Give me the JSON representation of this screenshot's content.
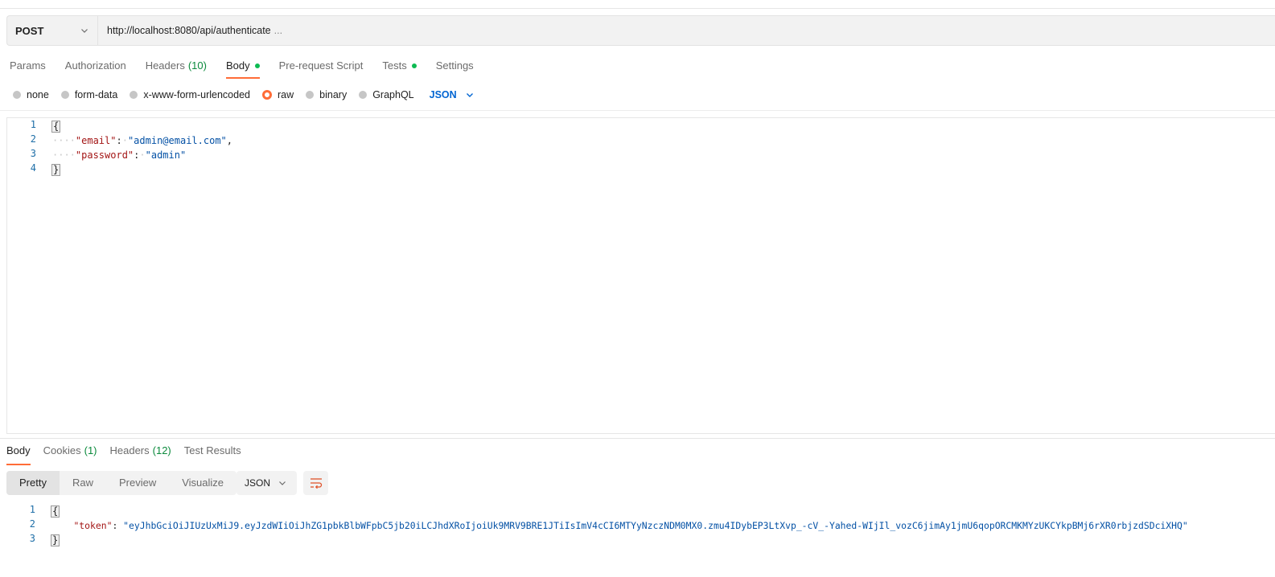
{
  "request": {
    "method": "POST",
    "url": "http://localhost:8080/api/authenticate",
    "url_overflow": "..."
  },
  "request_tabs": [
    {
      "label": "Params"
    },
    {
      "label": "Authorization"
    },
    {
      "label": "Headers",
      "count": "(10)"
    },
    {
      "label": "Body",
      "dot": true
    },
    {
      "label": "Pre-request Script"
    },
    {
      "label": "Tests",
      "dot": true
    },
    {
      "label": "Settings"
    }
  ],
  "body_types": [
    "none",
    "form-data",
    "x-www-form-urlencoded",
    "raw",
    "binary",
    "GraphQL"
  ],
  "body_type_selected": "raw",
  "body_language": "JSON",
  "request_body": {
    "line_numbers": [
      "1",
      "2",
      "3",
      "4"
    ],
    "open_brace": "{",
    "close_brace": "}",
    "email_key": "\"email\"",
    "email_value": "\"admin@email.com\"",
    "password_key": "\"password\"",
    "password_value": "\"admin\""
  },
  "response_tabs": [
    {
      "label": "Body"
    },
    {
      "label": "Cookies",
      "count": "(1)"
    },
    {
      "label": "Headers",
      "count": "(12)"
    },
    {
      "label": "Test Results"
    }
  ],
  "response_views": [
    "Pretty",
    "Raw",
    "Preview",
    "Visualize"
  ],
  "response_format": "JSON",
  "response_body": {
    "line_numbers": [
      "1",
      "2",
      "3"
    ],
    "open_brace": "{",
    "close_brace": "}",
    "token_key": "\"token\"",
    "token_value": "\"eyJhbGciOiJIUzUxMiJ9.eyJzdWIiOiJhZG1pbkBlbWFpbC5jb20iLCJhdXRoIjoiUk9MRV9BRE1JTiIsImV4cCI6MTYyNzczNDM0MX0.zmu4IDybEP3LtXvp_-cV_-Yahed-WIjIl_vozC6jimAy1jmU6qopORCMKMYzUKCYkpBMj6rXR0rbjzdSDciXHQ\""
  },
  "colors": {
    "accent": "#ff6c37",
    "status_dot": "#0cbb52",
    "count_green": "#0b8a3c",
    "json_link_blue": "#0265d2",
    "json_key": "#a31515",
    "json_string": "#0451a5"
  },
  "icons": [
    "chevron-down-icon",
    "wrap-lines-icon"
  ]
}
